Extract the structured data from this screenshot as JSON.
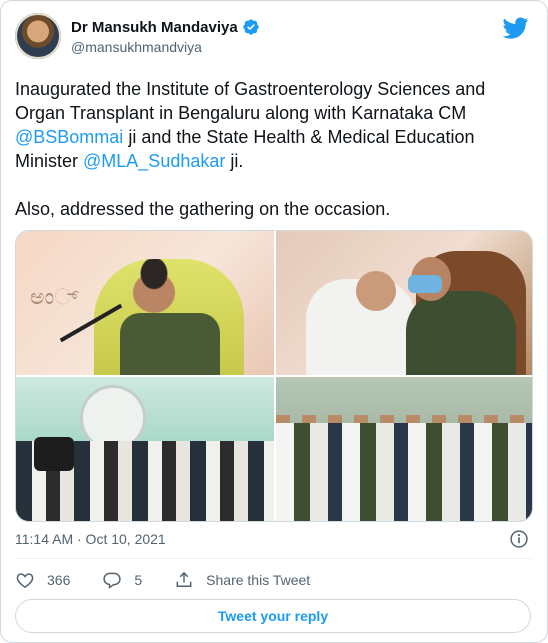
{
  "tweet": {
    "author_name": "Dr Mansukh Mandaviya",
    "author_handle": "@mansukhmandviya",
    "text_part1": "Inaugurated the Institute of Gastroenterology Sciences and Organ Transplant in Bengaluru along with Karnataka CM ",
    "mention1": "@BSBommai",
    "text_part2": " ji and the State Health & Medical Education Minister ",
    "mention2": "@MLA_Sudhakar",
    "text_part3": " ji.",
    "text_part4": "Also, addressed the gathering on the occasion.",
    "timestamp": "11:14 AM · Oct 10, 2021",
    "likes": "366",
    "replies": "5",
    "share_label": "Share this Tweet",
    "reply_button_label": "Tweet your reply"
  },
  "icons": {
    "verified": "verified-badge-icon",
    "brand": "twitter-bird-icon",
    "info": "info-icon",
    "like": "heart-icon",
    "reply": "speech-bubble-icon",
    "share": "share-upload-icon"
  },
  "colors": {
    "accent": "#1d9bf0",
    "text": "#0f1419",
    "secondary": "#536471",
    "border": "#cfd9de"
  }
}
